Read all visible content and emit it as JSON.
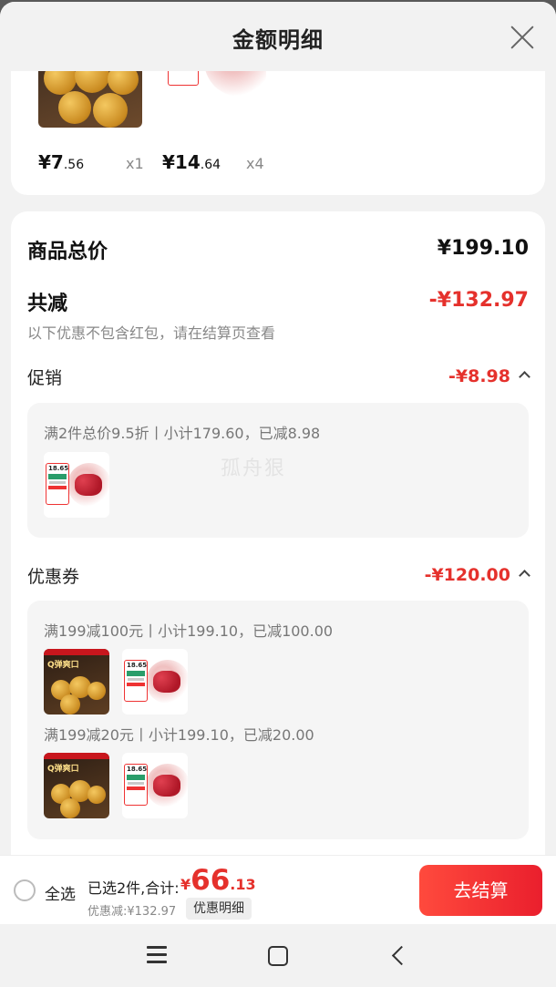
{
  "header": {
    "title": "金额明细",
    "close_icon": "close-icon"
  },
  "top_products": {
    "item_a": {
      "price_int": "¥7",
      "price_dec": ".56",
      "qty": "x1"
    },
    "item_b": {
      "price_int": "¥14",
      "price_dec": ".64",
      "qty": "x4"
    },
    "tag_price": "18.65"
  },
  "summary": {
    "total_label": "商品总价",
    "total_value": "¥199.10",
    "reduce_label": "共减",
    "reduce_value": "-¥132.97",
    "reduce_note": "以下优惠不包含红包，请在结算页查看"
  },
  "promotion": {
    "label": "促销",
    "value": "-¥8.98",
    "rule": "满2件总价9.5折丨小计179.60，已减8.98"
  },
  "coupon": {
    "label": "优惠券",
    "value": "-¥120.00",
    "rules": [
      "满199减100元丨小计199.10，已减100.00",
      "满199减20元丨小计199.10，已减20.00"
    ],
    "ball_title": "Q弹爽口"
  },
  "watermark": "孤舟狠",
  "bottom_bar": {
    "select_all": "全选",
    "selected_text": "已选2件,合计:",
    "total_currency": "¥",
    "total_int": "66",
    "total_dec": ".13",
    "discount_text": "优惠减:¥132.97",
    "detail_button": "优惠明细",
    "checkout_button": "去结算"
  },
  "colors": {
    "accent_red": "#e5312c",
    "checkout_gradient": [
      "#ff4a3d",
      "#ea1f2d"
    ]
  }
}
